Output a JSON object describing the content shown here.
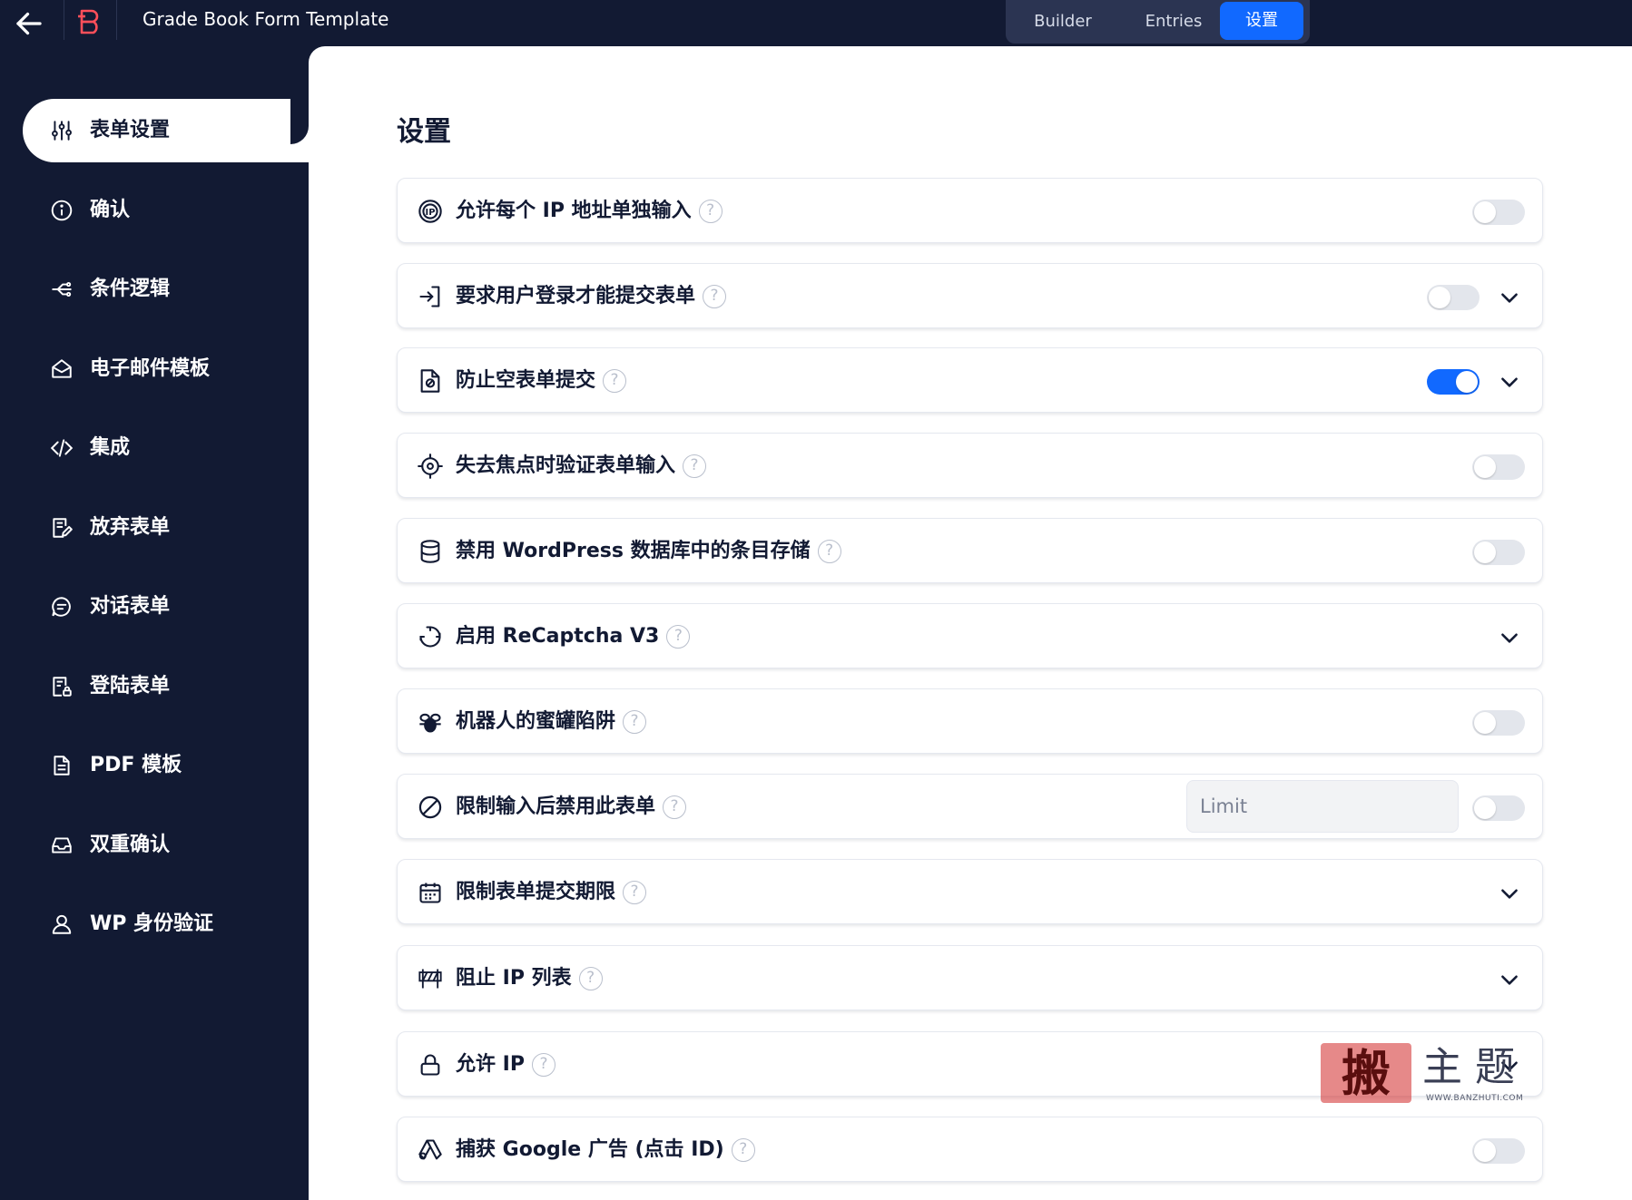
{
  "app": {
    "title": "Grade Book Form Template",
    "tabs": [
      "Builder",
      "Entries",
      "设置"
    ],
    "active_tab": "设置",
    "accent_color": "#1169ff",
    "dark_color": "#121a33"
  },
  "sidebar": {
    "items": [
      {
        "label": "表单设置",
        "icon": "sliders-icon",
        "active": true
      },
      {
        "label": "确认",
        "icon": "info-icon",
        "active": false
      },
      {
        "label": "条件逻辑",
        "icon": "share-icon",
        "active": false
      },
      {
        "label": "电子邮件模板",
        "icon": "mail-open-icon",
        "active": false
      },
      {
        "label": "集成",
        "icon": "code-icon",
        "active": false
      },
      {
        "label": "放弃表单",
        "icon": "document-edit-icon",
        "active": false
      },
      {
        "label": "对话表单",
        "icon": "chat-icon",
        "active": false
      },
      {
        "label": "登陆表单",
        "icon": "document-lock-icon",
        "active": false
      },
      {
        "label": "PDF 模板",
        "icon": "document-icon",
        "active": false
      },
      {
        "label": "双重确认",
        "icon": "inbox-icon",
        "active": false
      },
      {
        "label": "WP 身份验证",
        "icon": "user-icon",
        "active": false
      }
    ]
  },
  "main": {
    "title": "设置",
    "settings": [
      {
        "label": "允许每个 IP 地址单独输入",
        "icon": "ip-icon",
        "toggle": false,
        "expandable": false
      },
      {
        "label": "要求用户登录才能提交表单",
        "icon": "login-icon",
        "toggle": false,
        "expandable": true
      },
      {
        "label": "防止空表单提交",
        "icon": "empty-form-icon",
        "toggle": true,
        "expandable": true
      },
      {
        "label": "失去焦点时验证表单输入",
        "icon": "target-icon",
        "toggle": false,
        "expandable": false
      },
      {
        "label": "禁用 WordPress 数据库中的条目存储",
        "icon": "database-icon",
        "toggle": false,
        "expandable": false
      },
      {
        "label": "启用 ReCaptcha V3",
        "icon": "recaptcha-icon",
        "expandable": true
      },
      {
        "label": "机器人的蜜罐陷阱",
        "icon": "bee-icon",
        "toggle": false,
        "expandable": false
      },
      {
        "label": "限制输入后禁用此表单",
        "icon": "ban-icon",
        "toggle": false,
        "expandable": false,
        "input_placeholder": "Limit"
      },
      {
        "label": "限制表单提交期限",
        "icon": "calendar-icon",
        "expandable": true
      },
      {
        "label": "阻止 IP 列表",
        "icon": "barrier-icon",
        "expandable": true
      },
      {
        "label": "允许 IP",
        "icon": "lock-icon",
        "expandable": true
      },
      {
        "label": "捕获 Google 广告 (点击 ID)",
        "icon": "google-ads-icon",
        "toggle": false,
        "expandable": false
      }
    ]
  },
  "watermark": {
    "stamp": "搬",
    "text": "主题",
    "url": "WWW.BANZHUTI.COM"
  }
}
